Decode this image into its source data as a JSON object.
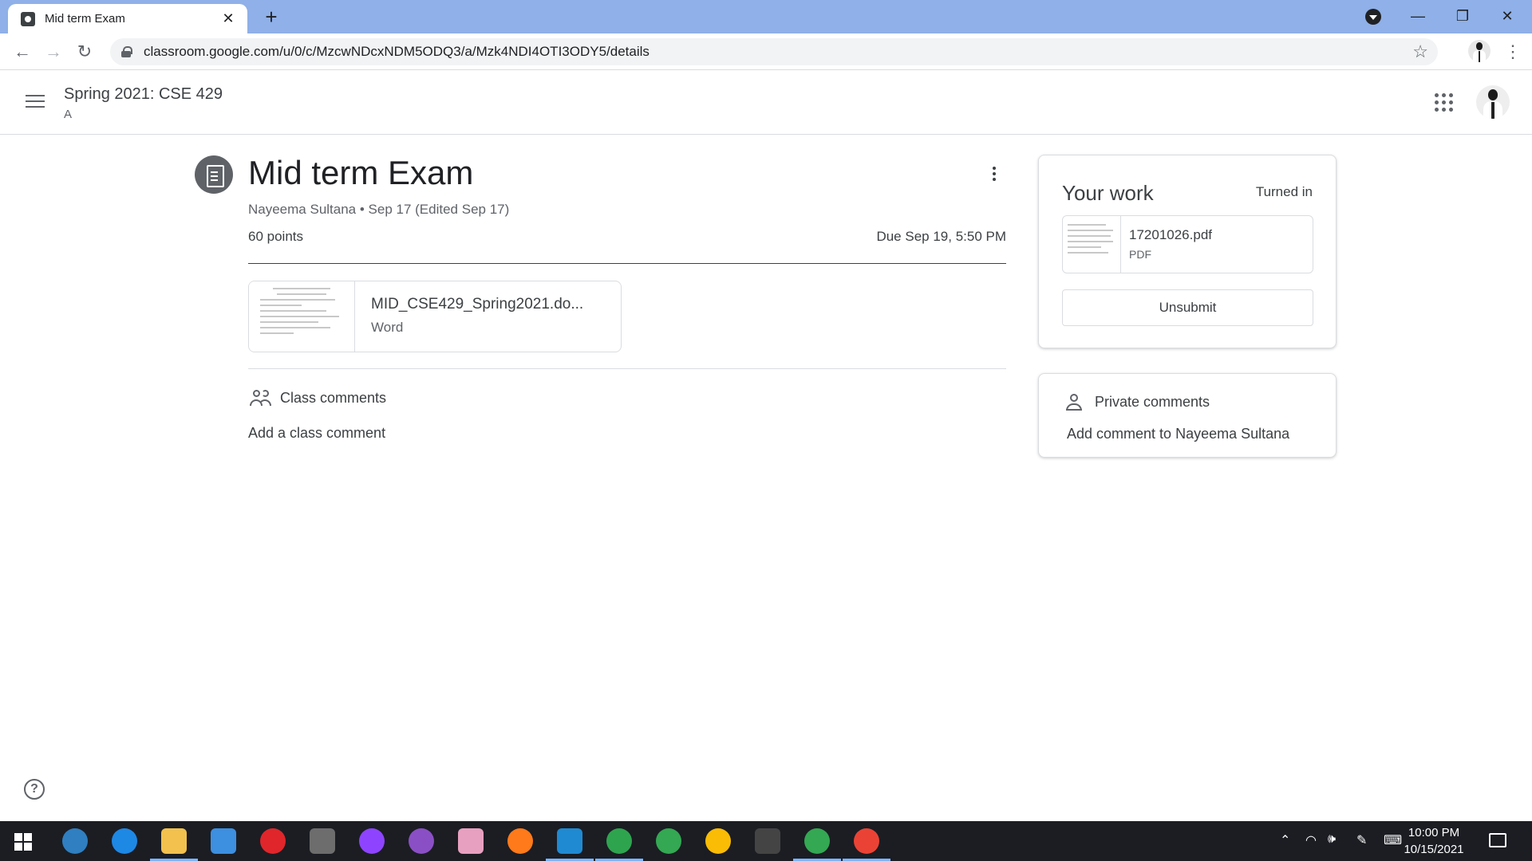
{
  "browser": {
    "tab_title": "Mid term Exam",
    "tab_close": "✕",
    "new_tab": "+",
    "url": "classroom.google.com/u/0/c/MzcwNDcxNDM5ODQ3/a/Mzk4NDI4OTI3ODY5/details",
    "window_controls": {
      "minimize": "—",
      "maximize": "❐",
      "close": "✕"
    },
    "nav": {
      "back": "←",
      "forward": "→",
      "reload": "↻"
    },
    "star": "☆",
    "menu": "⋮"
  },
  "classroom": {
    "class_title": "Spring 2021: CSE 429",
    "class_section": "A"
  },
  "assignment": {
    "title": "Mid term Exam",
    "author_line": "Nayeema Sultana • Sep 17 (Edited Sep 17)",
    "points": "60 points",
    "due": "Due Sep 19, 5:50 PM",
    "attachment": {
      "name": "MID_CSE429_Spring2021.do...",
      "type": "Word"
    },
    "class_comments_label": "Class comments",
    "add_class_comment": "Add a class comment"
  },
  "your_work": {
    "title": "Your work",
    "status": "Turned in",
    "file": {
      "name": "17201026.pdf",
      "type": "PDF"
    },
    "unsubmit_label": "Unsubmit"
  },
  "private_comments": {
    "label": "Private comments",
    "add_label": "Add comment to Nayeema Sultana"
  },
  "help": "?",
  "taskbar": {
    "time": "10:00 PM",
    "date": "10/15/2021",
    "apps": [
      {
        "name": "quickbooks-icon",
        "color": "#2f7fc1"
      },
      {
        "name": "edge-icon",
        "color": "#1e88e5"
      },
      {
        "name": "file-explorer-icon",
        "color": "#f2c14e"
      },
      {
        "name": "mail-icon",
        "color": "#3d8fe0"
      },
      {
        "name": "opera-icon",
        "color": "#e0262b"
      },
      {
        "name": "inkscape-icon",
        "color": "#6d6d6d"
      },
      {
        "name": "messenger-icon",
        "color": "#8e44ff"
      },
      {
        "name": "github-desktop-icon",
        "color": "#8b4fc5"
      },
      {
        "name": "paint-icon",
        "color": "#e8a0c0"
      },
      {
        "name": "firefox-icon",
        "color": "#ff7a1a"
      },
      {
        "name": "vscode-icon",
        "color": "#1f8ad2"
      },
      {
        "name": "ie-icon",
        "color": "#2fa44f"
      },
      {
        "name": "chrome-icon",
        "color": "#34a853"
      },
      {
        "name": "chrome-icon",
        "color": "#fbbc05"
      },
      {
        "name": "terminal-icon",
        "color": "#444444"
      },
      {
        "name": "chrome-profile-ek-icon",
        "color": "#34a853"
      },
      {
        "name": "chrome-active-icon",
        "color": "#ea4335"
      }
    ]
  }
}
